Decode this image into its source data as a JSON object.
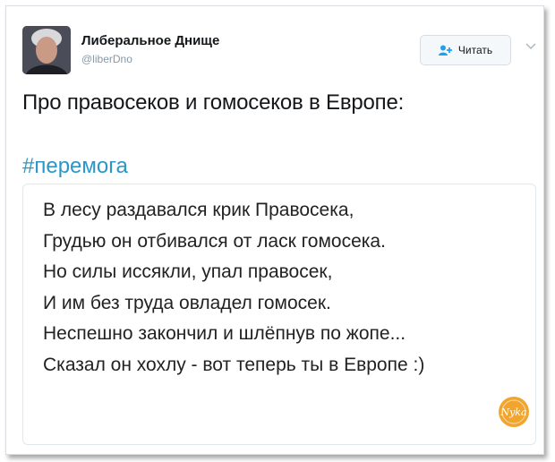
{
  "header": {
    "display_name": "Либеральное Днище",
    "handle": "@liberDno",
    "follow_label": "Читать"
  },
  "tweet": {
    "text": "Про правосеков и гомосеков в Европе:",
    "hashtag": "#перемога"
  },
  "image": {
    "poem_lines": [
      "В лесу раздавался крик Правосека,",
      "Грудью он отбивался от ласк гомосека.",
      "Но силы иссякли, упал правосек,",
      "И им без труда овладел гомосек.",
      "Неспешно закончил и шлёпнув по жопе...",
      "Сказал он хохлу - вот теперь ты в Европе :)"
    ],
    "watermark_text": "Nyka"
  },
  "colors": {
    "hashtag": "#2b96c8",
    "follow_icon": "#1da1f2",
    "watermark": "#f1a52f"
  },
  "icons": [
    "follow-user-icon",
    "chevron-down-icon"
  ]
}
